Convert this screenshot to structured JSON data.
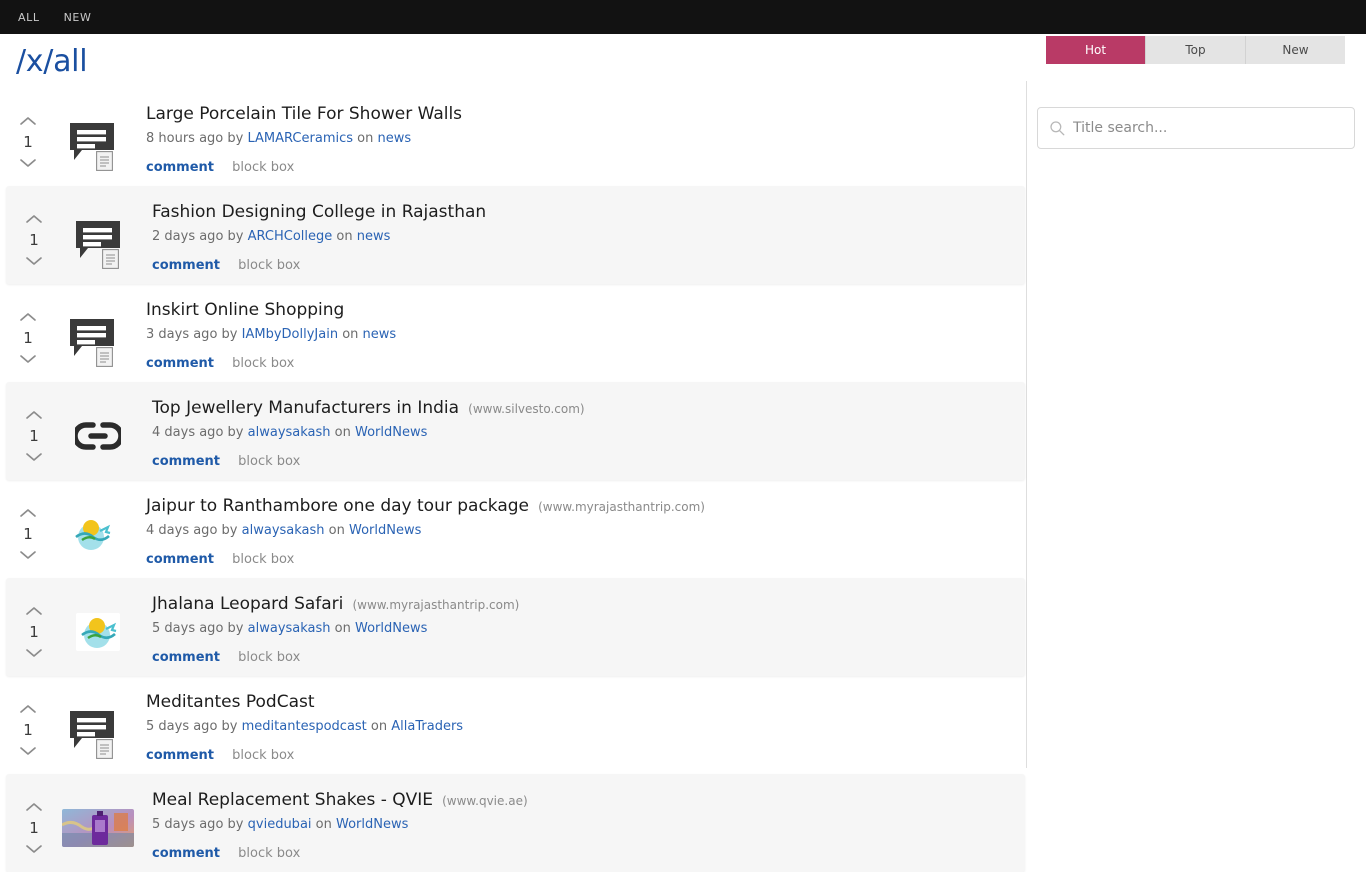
{
  "topnav": {
    "items": [
      {
        "label": "ALL",
        "name": "nav-all"
      },
      {
        "label": "NEW",
        "name": "nav-new"
      }
    ]
  },
  "header": {
    "title": "/x/all",
    "title_color": "#1a4fa0"
  },
  "sort_tabs": {
    "active_color": "#b93a66",
    "items": [
      {
        "label": "Hot",
        "active": true
      },
      {
        "label": "Top",
        "active": false
      },
      {
        "label": "New",
        "active": false
      }
    ]
  },
  "search": {
    "placeholder": "Title search...",
    "value": "",
    "icon": "search-icon"
  },
  "actions": {
    "comment_label": "comment",
    "block_label": "block box"
  },
  "posts": [
    {
      "votes": "1",
      "title": "Large Porcelain Tile For Shower Walls",
      "domain": "",
      "age": "8 hours ago",
      "by": "by",
      "author": "LAMARCeramics",
      "on": "on",
      "board": "news",
      "thumb": "comment-bubble",
      "alt": false
    },
    {
      "votes": "1",
      "title": "Fashion Designing College in Rajasthan",
      "domain": "",
      "age": "2 days ago",
      "by": "by",
      "author": "ARCHCollege",
      "on": "on",
      "board": "news",
      "thumb": "comment-bubble",
      "alt": true
    },
    {
      "votes": "1",
      "title": "Inskirt Online Shopping",
      "domain": "",
      "age": "3 days ago",
      "by": "by",
      "author": "IAMbyDollyJain",
      "on": "on",
      "board": "news",
      "thumb": "comment-bubble",
      "alt": false
    },
    {
      "votes": "1",
      "title": "Top Jewellery Manufacturers in India",
      "domain": "(www.silvesto.com)",
      "age": "4 days ago",
      "by": "by",
      "author": "alwaysakash",
      "on": "on",
      "board": "WorldNews",
      "thumb": "link-icon",
      "alt": true
    },
    {
      "votes": "1",
      "title": "Jaipur to Ranthambore one day tour package",
      "domain": "(www.myrajasthantrip.com)",
      "age": "4 days ago",
      "by": "by",
      "author": "alwaysakash",
      "on": "on",
      "board": "WorldNews",
      "thumb": "logo-image",
      "alt": false
    },
    {
      "votes": "1",
      "title": "Jhalana Leopard Safari",
      "domain": "(www.myrajasthantrip.com)",
      "age": "5 days ago",
      "by": "by",
      "author": "alwaysakash",
      "on": "on",
      "board": "WorldNews",
      "thumb": "logo-image",
      "alt": true
    },
    {
      "votes": "1",
      "title": "Meditantes PodCast",
      "domain": "",
      "age": "5 days ago",
      "by": "by",
      "author": "meditantespodcast",
      "on": "on",
      "board": "AllaTraders",
      "thumb": "comment-bubble",
      "alt": false
    },
    {
      "votes": "1",
      "title": "Meal Replacement Shakes - QVIE",
      "domain": "(www.qvie.ae)",
      "age": "5 days ago",
      "by": "by",
      "author": "qviedubai",
      "on": "on",
      "board": "WorldNews",
      "thumb": "photo-image",
      "alt": true
    }
  ]
}
